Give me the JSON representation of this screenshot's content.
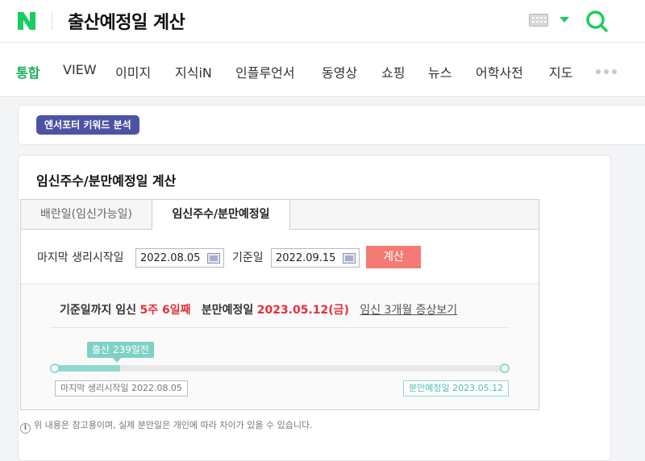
{
  "header": {
    "logo_letter": "N",
    "title": "출산예정일 계산",
    "brand_color": "#19ce60",
    "keyboard_icon": "keyboard-icon",
    "dropdown_icon": "caret-down-icon",
    "search_icon": "search-icon"
  },
  "nav": {
    "items": [
      "통합",
      "VIEW",
      "이미지",
      "지식iN",
      "인플루언서",
      "동영상",
      "쇼핑",
      "뉴스",
      "어학사전",
      "지도"
    ],
    "active_index": 0,
    "more_icon": "more-dots-icon"
  },
  "ads": {
    "badge": "엔서포터 키워드 분석"
  },
  "calculator": {
    "title": "임신주수/분만예정일 계산",
    "tabs": [
      "배란일(임신가능일)",
      "임신주수/분만예정일"
    ],
    "active_tab": 1,
    "last_period_label": "마지막 생리시작일",
    "last_period_value": "2022.08.05",
    "base_date_label": "기준일",
    "base_date_value": "2022.09.15",
    "calc_button": "계산",
    "result": {
      "prefix": "기준일까지 임신",
      "weeks": "5주 6일째",
      "due_label": "분만예정일",
      "due_date": "2023.05.12(금)",
      "link": "임신 3개월 증상보기"
    },
    "progress": {
      "tooltip": "출산 239일전",
      "fraction_elapsed": 0.146,
      "start_label": "마지막 생리시작일 2022.08.05",
      "end_label": "분만예정일 2023.05.12"
    },
    "notice": "위 내용은 참고용이며, 실제 분만일은 개인에 따라 차이가 있을 수 있습니다."
  }
}
